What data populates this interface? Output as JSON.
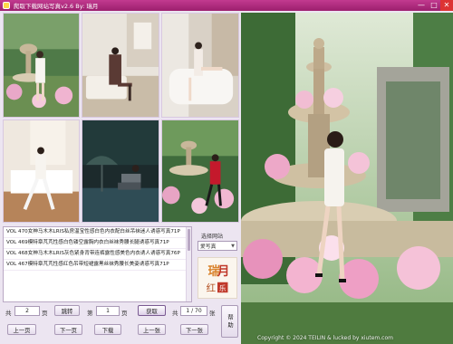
{
  "window": {
    "title": "爬取下载网站写真v2.6    By:  瑞月",
    "controls": {
      "minimize": "—",
      "maximize": "□",
      "close": "✕"
    }
  },
  "thumbnails": [
    {
      "name": "thumb-garden-white-dress"
    },
    {
      "name": "thumb-bedroom-brown-dress"
    },
    {
      "name": "thumb-bathtub"
    },
    {
      "name": "thumb-white-room-stockings"
    },
    {
      "name": "thumb-night-pool"
    },
    {
      "name": "thumb-fountain-red-dress"
    }
  ],
  "list": {
    "items": [
      "VOL 470女神马木木LRIS私房温宝性感白色内衣配白丝吊袜迷人诱惑写真71P",
      "VOL 469模特章芃芃性感白色镂空露胸内衣白丝袜秀腰长腿诱惑写真71P",
      "VOL 468女神马木木LRIS灰色紧身背带连裤露性感美色内衣诱人诱惑写真76P",
      "VOL 467模特章芃芃性感红色吊带短裙露黑丝袜秀腰长美姿诱惑写真71P"
    ]
  },
  "site_panel": {
    "label": "选择网站",
    "selected": "爱写真"
  },
  "logo_text": [
    "瑞",
    "月",
    "红",
    "乐"
  ],
  "controls": {
    "total_prefix": "共",
    "total_pages": "2",
    "page_unit": "页",
    "jump_button": "跳转",
    "page_prefix": "第",
    "page_value": "1",
    "page_suffix": "页",
    "fetch_button": "获取",
    "count_prefix": "共",
    "count_value": "1 / 70",
    "count_unit": "张",
    "prev_page_button": "上一页",
    "next_page_button": "下一页",
    "prev_button": "上一张",
    "next_button": "下一张",
    "download_button": "下载",
    "help_button": "帮助"
  },
  "preview": {
    "credit": "Copyright © 2024 TEILIN & lucked by xiutem.com"
  },
  "colors": {
    "titlebar": "#b02a80",
    "accent": "#7a5a92",
    "window_bg": "#ece5f1"
  }
}
